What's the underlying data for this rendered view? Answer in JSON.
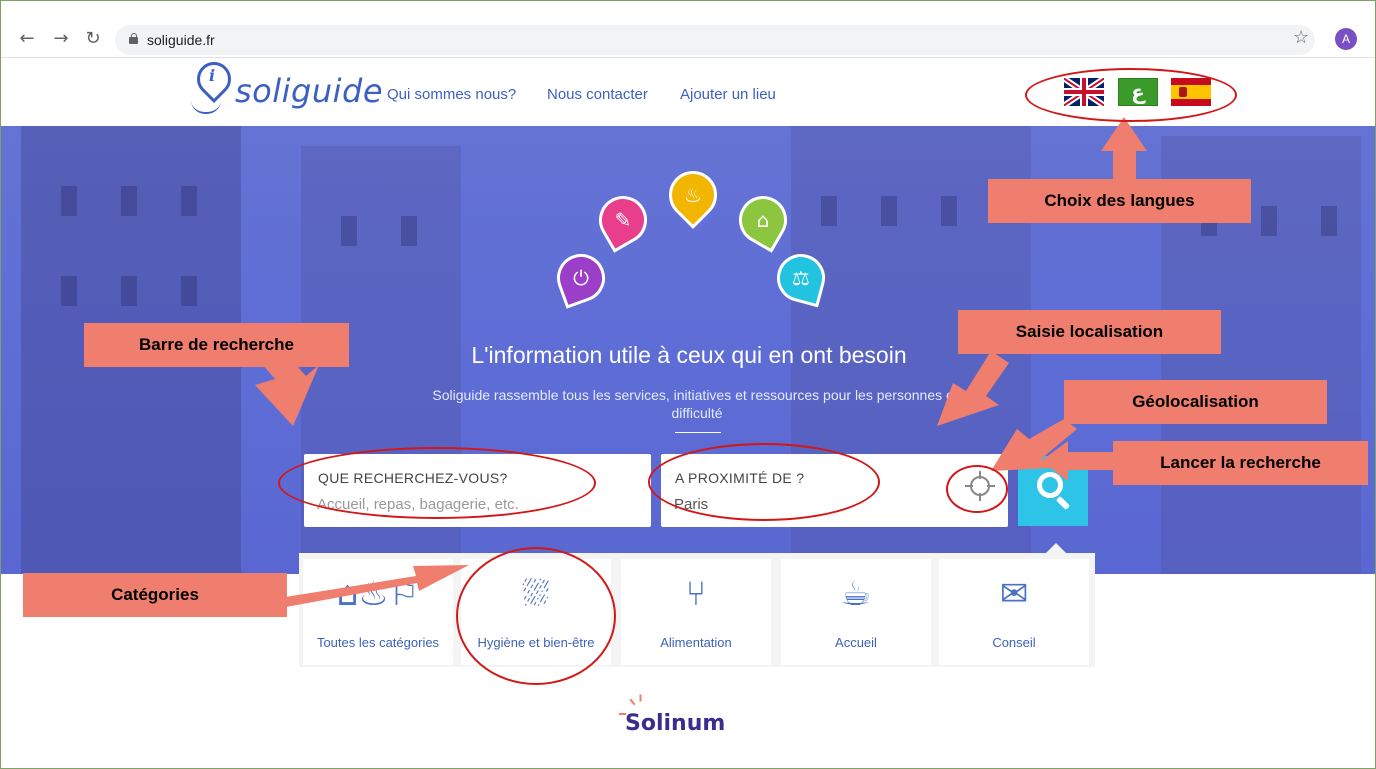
{
  "browser": {
    "url": "soliguide.fr",
    "profile_initial": "A",
    "icons": [
      "back-icon",
      "forward-icon",
      "reload-icon",
      "lock-icon",
      "star-icon"
    ]
  },
  "header": {
    "logo_text": "soliguide",
    "nav": [
      "Qui sommes nous?",
      "Nous contacter",
      "Ajouter un lieu"
    ],
    "flags": [
      "uk-flag",
      "arabic-flag",
      "spanish-flag"
    ],
    "arabic_glyph": "ع"
  },
  "hero": {
    "title": "L'information utile à ceux qui en ont besoin",
    "subtitle": "Soliguide rassemble tous les services, initiatives et ressources pour les personnes en difficulté",
    "category_pins": [
      {
        "icon": "brush-icon",
        "color": "#e83e8c"
      },
      {
        "icon": "meal-icon",
        "color": "#f2b500"
      },
      {
        "icon": "house-icon",
        "color": "#8cc63f"
      },
      {
        "icon": "plug-icon",
        "color": "#9b3fc9"
      },
      {
        "icon": "scale-icon",
        "color": "#22c3e0"
      }
    ]
  },
  "search": {
    "what_label": "QUE RECHERCHEZ-VOUS?",
    "what_placeholder": "Accueil, repas, bagagerie, etc.",
    "where_label": "A PROXIMITÉ DE ?",
    "where_value": "Paris",
    "accent": "#2ec4e7"
  },
  "categories": [
    {
      "label": "Toutes les catégories",
      "icon": "all-categories-icon"
    },
    {
      "label": "Hygiène et bien-être",
      "icon": "shower-icon"
    },
    {
      "label": "Alimentation",
      "icon": "fork-knife-icon"
    },
    {
      "label": "Accueil",
      "icon": "coffee-cup-icon"
    },
    {
      "label": "Conseil",
      "icon": "envelope-icon"
    }
  ],
  "footer": {
    "brand": "Solinum"
  },
  "annotations": {
    "languages": "Choix des langues",
    "search_bar": "Barre de recherche",
    "location": "Saisie localisation",
    "geolocation": "Géolocalisation",
    "launch": "Lancer la recherche",
    "categories": "Catégories",
    "callout_color": "#f07e6e",
    "ellipse_color": "#d31616"
  }
}
